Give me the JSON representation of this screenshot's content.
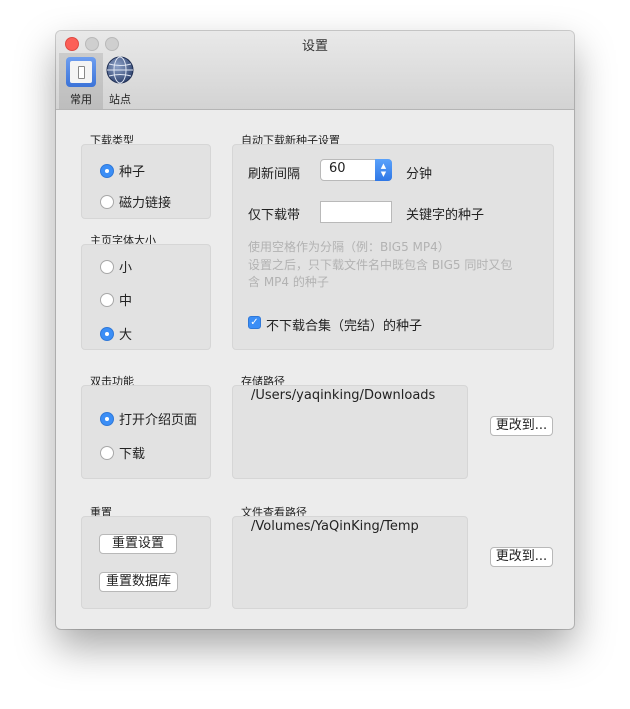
{
  "window": {
    "title": "设置"
  },
  "toolbar": {
    "items": [
      {
        "label": "常用",
        "icon": "general-icon",
        "selected": true
      },
      {
        "label": "站点",
        "icon": "globe-icon",
        "selected": false
      }
    ]
  },
  "download_type": {
    "label": "下载类型",
    "options": [
      {
        "label": "种子",
        "selected": true
      },
      {
        "label": "磁力链接",
        "selected": false
      }
    ]
  },
  "font_size": {
    "label": "主页字体大小",
    "options": [
      {
        "label": "小",
        "selected": false
      },
      {
        "label": "中",
        "selected": false
      },
      {
        "label": "大",
        "selected": true
      }
    ]
  },
  "auto_download": {
    "label": "自动下载新种子设置",
    "refresh_label": "刷新间隔",
    "refresh_value": "60",
    "refresh_unit": "分钟",
    "only_label": "仅下载带",
    "only_value": "",
    "keyword_label": "关键字的种子",
    "hint_line1": "使用空格作为分隔（例：BIG5 MP4）",
    "hint_line2": "设置之后，只下载文件名中既包含 BIG5 同时又包",
    "hint_line3": "含 MP4 的种子",
    "exclude_label": "不下载合集（完结）的种子",
    "exclude_checked": true
  },
  "double_click": {
    "label": "双击功能",
    "options": [
      {
        "label": "打开介绍页面",
        "selected": true
      },
      {
        "label": "下载",
        "selected": false
      }
    ]
  },
  "storage": {
    "label": "存储路径",
    "path": "/Users/yaqinking/Downloads",
    "change_label": "更改到..."
  },
  "reset": {
    "label": "重置",
    "reset_settings": "重置设置",
    "reset_database": "重置数据库"
  },
  "file_view": {
    "label": "文件查看路径",
    "path": "/Volumes/YaQinKing/Temp",
    "change_label": "更改到..."
  }
}
